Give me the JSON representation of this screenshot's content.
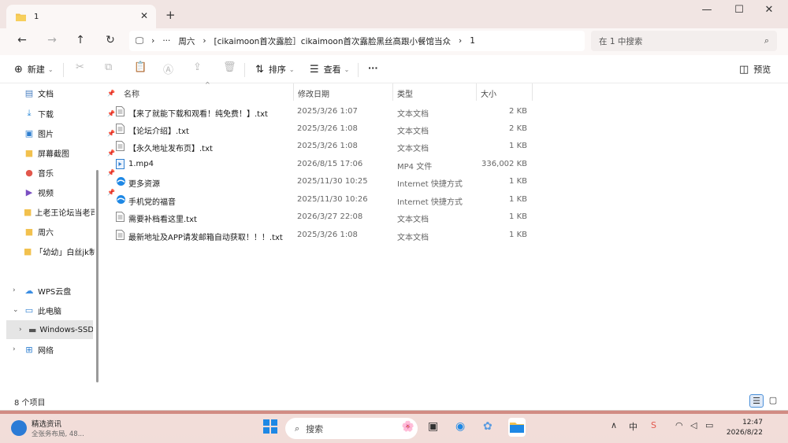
{
  "window": {
    "tab_title": "1",
    "new_tab": "+",
    "controls": {
      "minimize": "—",
      "maximize": "☐",
      "close": "✕"
    }
  },
  "nav": {
    "breadcrumb": [
      "周六",
      "[cikaimoon首次露脸］cikaimoon首次露脸黑丝高跟小餐馆当众",
      "1"
    ],
    "ellipsis": "···",
    "search_placeholder": "在 1 中搜索"
  },
  "toolbar": {
    "new_label": "新建",
    "sort_label": "排序",
    "view_label": "查看",
    "more_label": "···",
    "preview_label": "预览"
  },
  "sidebar": {
    "quick_access": [
      {
        "label": "文档",
        "icon": "document-icon",
        "pinned": true
      },
      {
        "label": "下载",
        "icon": "download-icon",
        "pinned": true
      },
      {
        "label": "图片",
        "icon": "picture-icon",
        "pinned": true
      },
      {
        "label": "屏幕截图",
        "icon": "folder-icon",
        "pinned": true
      },
      {
        "label": "音乐",
        "icon": "music-icon",
        "pinned": true
      },
      {
        "label": "视频",
        "icon": "video-icon",
        "pinned": true
      },
      {
        "label": "上老王论坛当老司",
        "icon": "folder-icon",
        "pinned": false
      },
      {
        "label": "周六",
        "icon": "folder-icon",
        "pinned": false
      },
      {
        "label": "「幼幼」白丝jk制",
        "icon": "folder-icon",
        "pinned": false
      }
    ],
    "tree": [
      {
        "label": "WPS云盘",
        "icon": "cloud-icon",
        "chevron": "›"
      },
      {
        "label": "此电脑",
        "icon": "computer-icon",
        "chevron": "⌄"
      },
      {
        "label": "Windows-SSD",
        "icon": "drive-icon",
        "chevron": "›"
      },
      {
        "label": "网络",
        "icon": "network-icon",
        "chevron": "›"
      }
    ]
  },
  "columns": {
    "name": "名称",
    "date": "修改日期",
    "type": "类型",
    "size": "大小"
  },
  "files": [
    {
      "name": "【来了就能下载和观看！纯免费！】.txt",
      "date": "2025/3/26 1:07",
      "type": "文本文档",
      "size": "2 KB",
      "icon": "text-file-icon"
    },
    {
      "name": "【论坛介绍】.txt",
      "date": "2025/3/26 1:08",
      "type": "文本文档",
      "size": "2 KB",
      "icon": "text-file-icon"
    },
    {
      "name": "【永久地址发布页】.txt",
      "date": "2025/3/26 1:08",
      "type": "文本文档",
      "size": "1 KB",
      "icon": "text-file-icon"
    },
    {
      "name": "1.mp4",
      "date": "2026/8/15 17:06",
      "type": "MP4 文件",
      "size": "336,002 KB",
      "icon": "video-file-icon"
    },
    {
      "name": "更多资源",
      "date": "2025/11/30 10:25",
      "type": "Internet 快捷方式",
      "size": "1 KB",
      "icon": "internet-shortcut-icon"
    },
    {
      "name": "手机党的福音",
      "date": "2025/11/30 10:26",
      "type": "Internet 快捷方式",
      "size": "1 KB",
      "icon": "internet-shortcut-icon"
    },
    {
      "name": "需要补档看这里.txt",
      "date": "2026/3/27 22:08",
      "type": "文本文档",
      "size": "1 KB",
      "icon": "text-file-icon"
    },
    {
      "name": "最新地址及APP请发邮箱自动获取！！！.txt",
      "date": "2025/3/26 1:08",
      "type": "文本文档",
      "size": "1 KB",
      "icon": "text-file-icon"
    }
  ],
  "status": {
    "item_count": "8 个项目"
  },
  "taskbar": {
    "news_title": "精选资讯",
    "news_sub": "全张务布局, 48...",
    "search_label": "搜索",
    "time": "12:47",
    "date": "2026/8/22"
  },
  "colors": {
    "folder": "#f2c14e",
    "accent": "#1e6fd9",
    "wallpaper": "#d98f86"
  }
}
